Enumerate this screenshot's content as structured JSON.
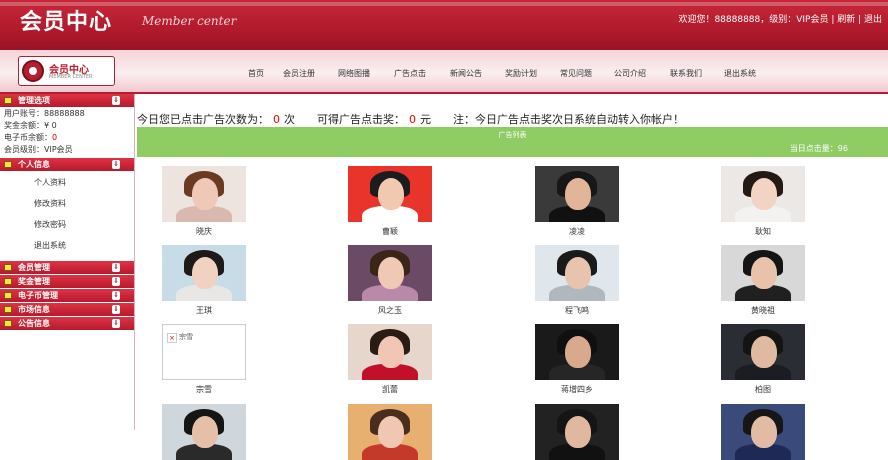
{
  "header": {
    "title": "会员中心",
    "subtitle": "Member center",
    "user_info": "欢迎您！88888888，级别：VIP会员 | 刷新 | 退出"
  },
  "logo": {
    "text": "会员中心",
    "small": "MEMBER CENTER"
  },
  "nav": [
    "首页",
    "会员注册",
    "网络图播",
    "广告点击",
    "新闻公告",
    "奖励计划",
    "常见问题",
    "公司介绍",
    "联系我们",
    "退出系统"
  ],
  "sidebar": {
    "sections": [
      {
        "title": "管理选项"
      },
      {
        "title": "个人信息"
      },
      {
        "title": "会员管理"
      },
      {
        "title": "奖金管理"
      },
      {
        "title": "电子币管理"
      },
      {
        "title": "市场信息"
      },
      {
        "title": "公告信息"
      }
    ],
    "account": {
      "user_label": "用户账号：",
      "user_value": "88888888",
      "bonus_label": "奖金余额：",
      "bonus_value": "¥ 0",
      "ecoin_label": "电子币余额：",
      "ecoin_value": "0",
      "level_label": "会员级别：",
      "level_value": "VIP会员"
    },
    "personal_links": [
      "个人资料",
      "修改资料",
      "修改密码",
      "退出系统"
    ]
  },
  "notice": {
    "part1": "今日您已点击广告次数为：",
    "clicks": "0",
    "part2": "次　　可得广告点击奖：",
    "reward": "0",
    "part3": "元　　注：今日广告点击奖次日系统自动转入你帐户！"
  },
  "ad_bar": {
    "title": "广告列表",
    "count": "当日点击量：96"
  },
  "people": [
    {
      "name": "晓庆",
      "skin": "#f0c8b8",
      "hair": "#6a3b22",
      "bg": "#ede4e0",
      "body": "#d9b8b0"
    },
    {
      "name": "曹颖",
      "skin": "#f1c9b0",
      "hair": "#1c1c1c",
      "bg": "#e9342b",
      "body": "#ffffff"
    },
    {
      "name": "凌凌",
      "skin": "#e2b59a",
      "hair": "#171717",
      "bg": "#3a3a3a",
      "body": "#111111"
    },
    {
      "name": "耿知",
      "skin": "#f3d3c3",
      "hair": "#231a15",
      "bg": "#ece8e6",
      "body": "#f4f2f0"
    },
    {
      "name": "王琪",
      "skin": "#f1d2c0",
      "hair": "#1e1a18",
      "bg": "#c8dce8",
      "body": "#e9e6e6"
    },
    {
      "name": "风之玉",
      "skin": "#f0c9b5",
      "hair": "#3b2418",
      "bg": "#6b4a66",
      "body": "#b88aa8"
    },
    {
      "name": "程飞鸣",
      "skin": "#e8c3ad",
      "hair": "#1a1a1a",
      "bg": "#dfe6ec",
      "body": "#b0b8be"
    },
    {
      "name": "黄晓祖",
      "skin": "#e9c2ac",
      "hair": "#151515",
      "bg": "#d8d8d8",
      "body": "#202020"
    },
    {
      "name": "",
      "skin": "",
      "hair": "",
      "bg": "",
      "body": ""
    },
    {
      "name": "凯蕾",
      "skin": "#f1c6b4",
      "hair": "#2a1b14",
      "bg": "#e6d6cc",
      "body": "#c0102a"
    },
    {
      "name": "蒋增四乡",
      "skin": "#d9a98e",
      "hair": "#101010",
      "bg": "#1a1a1a",
      "body": "#262626"
    },
    {
      "name": "柏图",
      "skin": "#e0b9a2",
      "hair": "#141414",
      "bg": "#2a2d33",
      "body": "#1b1d22"
    }
  ],
  "broken_image_text": "宗雪",
  "broken_caption": "宗雪",
  "bottom_row": [
    {
      "skin": "#e6bfa8",
      "hair": "#151515",
      "bg": "#cfd7dd",
      "body": "#2a2a2a"
    },
    {
      "skin": "#efc7b2",
      "hair": "#4a2d1c",
      "bg": "#e8b070",
      "body": "#c43a2a"
    },
    {
      "skin": "#e0b79f",
      "hair": "#151515",
      "bg": "#222",
      "body": "#111"
    },
    {
      "skin": "#e2bba5",
      "hair": "#161616",
      "bg": "#3a4a7a",
      "body": "#1e2a55"
    }
  ]
}
